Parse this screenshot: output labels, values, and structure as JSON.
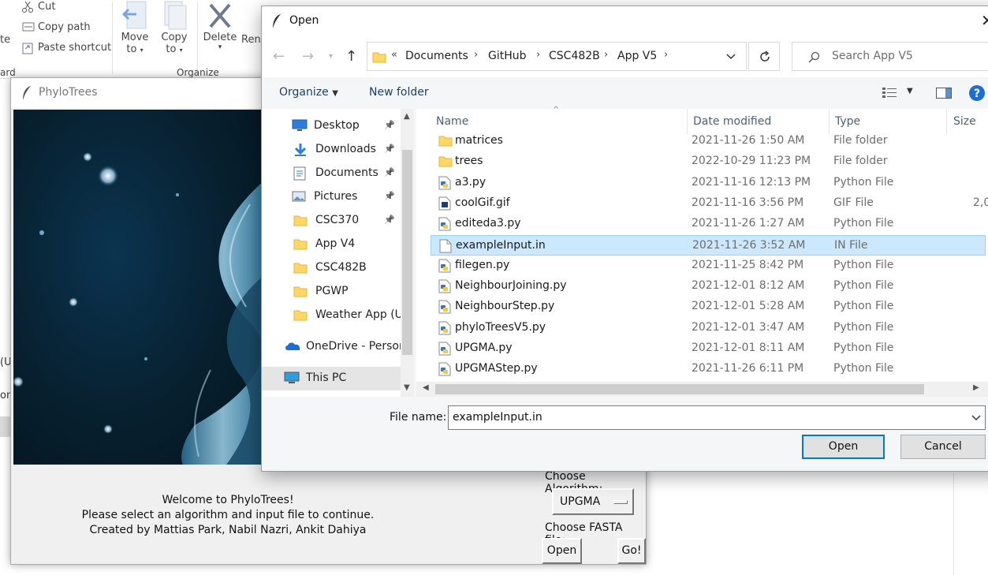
{
  "ribbon": {
    "cut": "Cut",
    "copy_path": "Copy path",
    "paste_shortcut": "Paste shortcut",
    "clipboard_partial": "ard",
    "move_to_1": "Move",
    "move_to_2": "to",
    "copy_to_1": "Copy",
    "copy_to_2": "to",
    "delete": "Delete",
    "rename_partial": "Rena",
    "organize_group": "Organize",
    "left_partial_1": "te",
    "left_partial_2": "(U",
    "left_partial_3": "on"
  },
  "phylo": {
    "title": "PhyloTrees",
    "welcome": "Welcome to PhyloTrees!",
    "instruction": "Please select an algorithm and input file to continue.",
    "credits": "Created by Mattias Park, Nabil Nazri, Ankit Dahiya",
    "choose_algorithm": "Choose Algorithm:",
    "algorithm_value": "UPGMA",
    "choose_fasta": "Choose FASTA file:",
    "open_btn": "Open",
    "go_btn": "Go!"
  },
  "dialog": {
    "title": "Open",
    "breadcrumb_prefix": "«",
    "breadcrumb": [
      "Documents",
      "GitHub",
      "CSC482B",
      "App V5"
    ],
    "search_placeholder": "Search App V5",
    "organize": "Organize",
    "new_folder": "New folder",
    "nav": [
      {
        "label": "Desktop",
        "icon": "desktop-icon",
        "pinned": true
      },
      {
        "label": "Downloads",
        "icon": "download-icon",
        "pinned": true
      },
      {
        "label": "Documents",
        "icon": "documents-icon",
        "pinned": true
      },
      {
        "label": "Pictures",
        "icon": "pictures-icon",
        "pinned": true
      },
      {
        "label": "CSC370",
        "icon": "folder-icon",
        "pinned": true
      },
      {
        "label": "App V4",
        "icon": "folder-icon",
        "pinned": false
      },
      {
        "label": "CSC482B",
        "icon": "folder-icon",
        "pinned": false
      },
      {
        "label": "PGWP",
        "icon": "folder-icon",
        "pinned": false
      },
      {
        "label": "Weather App (UI",
        "icon": "folder-icon",
        "pinned": false
      },
      {
        "label": "OneDrive - Persor",
        "icon": "onedrive-icon",
        "pinned": false
      },
      {
        "label": "This PC",
        "icon": "computer-icon",
        "pinned": false
      }
    ],
    "columns": {
      "name": "Name",
      "date": "Date modified",
      "type": "Type",
      "size": "Size"
    },
    "files": [
      {
        "name": "matrices",
        "date": "2021-11-26 1:50 AM",
        "type": "File folder",
        "size": "",
        "icon": "folder"
      },
      {
        "name": "trees",
        "date": "2022-10-29 11:23 PM",
        "type": "File folder",
        "size": "",
        "icon": "folder"
      },
      {
        "name": "a3.py",
        "date": "2021-11-16 12:13 PM",
        "type": "Python File",
        "size": "",
        "icon": "python"
      },
      {
        "name": "coolGif.gif",
        "date": "2021-11-16 3:56 PM",
        "type": "GIF File",
        "size": "2,0",
        "icon": "gif"
      },
      {
        "name": "editeda3.py",
        "date": "2021-11-26 1:27 AM",
        "type": "Python File",
        "size": "",
        "icon": "python"
      },
      {
        "name": "exampleInput.in",
        "date": "2021-11-26 3:52 AM",
        "type": "IN File",
        "size": "",
        "icon": "file",
        "selected": true
      },
      {
        "name": "filegen.py",
        "date": "2021-11-25 8:42 PM",
        "type": "Python File",
        "size": "",
        "icon": "python"
      },
      {
        "name": "NeighbourJoining.py",
        "date": "2021-12-01 8:12 AM",
        "type": "Python File",
        "size": "",
        "icon": "python"
      },
      {
        "name": "NeighbourStep.py",
        "date": "2021-12-01 5:28 AM",
        "type": "Python File",
        "size": "",
        "icon": "python"
      },
      {
        "name": "phyloTreesV5.py",
        "date": "2021-12-01 3:47 AM",
        "type": "Python File",
        "size": "",
        "icon": "python"
      },
      {
        "name": "UPGMA.py",
        "date": "2021-12-01 8:11 AM",
        "type": "Python File",
        "size": "",
        "icon": "python"
      },
      {
        "name": "UPGMAStep.py",
        "date": "2021-11-26 6:11 PM",
        "type": "Python File",
        "size": "",
        "icon": "python"
      }
    ],
    "file_name_label": "File name:",
    "file_name_value": "exampleInput.in",
    "open": "Open",
    "cancel": "Cancel"
  },
  "colors": {
    "accent": "#0078d7",
    "selection": "#cce8ff",
    "folder": "#ffd766",
    "link": "#1f3f68"
  }
}
